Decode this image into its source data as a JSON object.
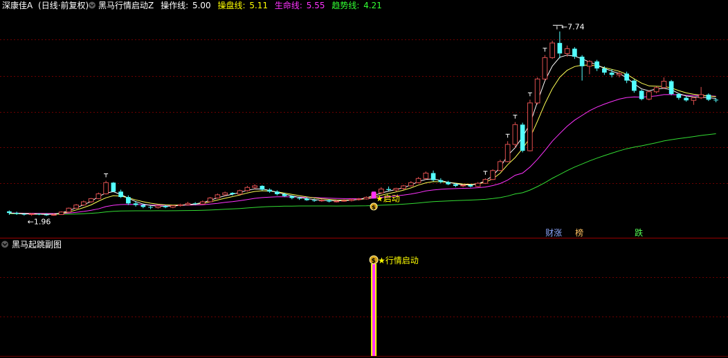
{
  "main_header": {
    "stock": "深康佳A",
    "period": "(日线·前复权)",
    "indicator": "黑马行情启动Z",
    "cz_label": "操作线:",
    "cz_value": "5.00",
    "cp_label": "操盘线:",
    "cp_value": "5.11",
    "sm_label": "生命线:",
    "sm_value": "5.55",
    "qs_label": "趋势线:",
    "qs_value": "4.21"
  },
  "sub_header": {
    "title": "黑马起跳副图"
  },
  "signals": {
    "start_main": "启动",
    "start_sub": "行情启动",
    "dollar": "$"
  },
  "news_tags": [
    "财涨",
    "榜",
    "跌"
  ],
  "colors": {
    "bg": "#000000",
    "grid": "#6e0000",
    "up": "#e05050",
    "down": "#54ffff",
    "ma_white": "#ffffff",
    "ma_yellow": "#ffff55",
    "ma_magenta": "#ff33ff",
    "ma_green": "#33dd33",
    "header_white": "#ffffff",
    "header_yellow": "#ffff00",
    "header_magenta": "#ff33ff",
    "header_green": "#33ff33",
    "tag_blue": "#8da8ff",
    "tag_orange": "#ffc060",
    "tag_green": "#55ff55"
  },
  "chart_data": {
    "type": "candlestick",
    "high_label": "7.74",
    "low_label": "1.96",
    "ylim": [
      1.75,
      8.25
    ],
    "ohlc": [
      [
        2.1,
        2.13,
        1.99,
        2.05
      ],
      [
        2.05,
        2.09,
        1.99,
        2.02
      ],
      [
        2.02,
        2.05,
        1.97,
        2.0
      ],
      [
        2.0,
        2.05,
        1.96,
        2.02
      ],
      [
        2.02,
        2.04,
        1.98,
        2.0
      ],
      [
        2.0,
        2.04,
        1.96,
        1.99
      ],
      [
        1.99,
        2.03,
        1.96,
        2.0
      ],
      [
        2.0,
        2.1,
        1.99,
        2.08
      ],
      [
        2.08,
        2.22,
        2.06,
        2.2
      ],
      [
        2.2,
        2.33,
        2.18,
        2.3
      ],
      [
        2.3,
        2.44,
        2.27,
        2.4
      ],
      [
        2.4,
        2.52,
        2.37,
        2.5
      ],
      [
        2.5,
        2.69,
        2.48,
        2.65
      ],
      [
        2.65,
        3.06,
        2.63,
        3.0
      ],
      [
        3.0,
        3.02,
        2.7,
        2.72
      ],
      [
        2.72,
        2.78,
        2.52,
        2.55
      ],
      [
        2.55,
        2.6,
        2.3,
        2.35
      ],
      [
        2.35,
        2.42,
        2.25,
        2.3
      ],
      [
        2.3,
        2.34,
        2.2,
        2.24
      ],
      [
        2.24,
        2.27,
        2.17,
        2.22
      ],
      [
        2.22,
        2.3,
        2.19,
        2.27
      ],
      [
        2.27,
        2.3,
        2.2,
        2.23
      ],
      [
        2.23,
        2.3,
        2.2,
        2.28
      ],
      [
        2.28,
        2.34,
        2.25,
        2.31
      ],
      [
        2.31,
        2.4,
        2.28,
        2.35
      ],
      [
        2.35,
        2.39,
        2.3,
        2.33
      ],
      [
        2.33,
        2.44,
        2.31,
        2.4
      ],
      [
        2.4,
        2.55,
        2.38,
        2.52
      ],
      [
        2.52,
        2.66,
        2.5,
        2.62
      ],
      [
        2.62,
        2.72,
        2.58,
        2.68
      ],
      [
        2.68,
        2.7,
        2.6,
        2.64
      ],
      [
        2.64,
        2.78,
        2.62,
        2.75
      ],
      [
        2.75,
        2.9,
        2.72,
        2.85
      ],
      [
        2.85,
        2.95,
        2.8,
        2.9
      ],
      [
        2.9,
        2.92,
        2.75,
        2.78
      ],
      [
        2.78,
        2.82,
        2.68,
        2.72
      ],
      [
        2.72,
        2.76,
        2.6,
        2.64
      ],
      [
        2.64,
        2.68,
        2.55,
        2.58
      ],
      [
        2.58,
        2.6,
        2.48,
        2.52
      ],
      [
        2.52,
        2.56,
        2.46,
        2.5
      ],
      [
        2.5,
        2.54,
        2.43,
        2.45
      ],
      [
        2.45,
        2.5,
        2.4,
        2.43
      ],
      [
        2.43,
        2.48,
        2.4,
        2.45
      ],
      [
        2.45,
        2.48,
        2.38,
        2.41
      ],
      [
        2.41,
        2.46,
        2.38,
        2.42
      ],
      [
        2.42,
        2.48,
        2.4,
        2.44
      ],
      [
        2.44,
        2.5,
        2.41,
        2.47
      ],
      [
        2.47,
        2.52,
        2.44,
        2.49
      ],
      [
        2.49,
        2.57,
        2.47,
        2.54
      ],
      [
        2.54,
        2.72,
        2.52,
        2.68
      ],
      [
        2.68,
        2.86,
        2.65,
        2.8
      ],
      [
        2.8,
        2.88,
        2.74,
        2.77
      ],
      [
        2.77,
        2.84,
        2.72,
        2.82
      ],
      [
        2.82,
        2.93,
        2.78,
        2.9
      ],
      [
        2.9,
        3.05,
        2.88,
        3.0
      ],
      [
        3.0,
        3.18,
        2.98,
        3.13
      ],
      [
        3.13,
        3.35,
        3.1,
        3.3
      ],
      [
        3.3,
        3.38,
        3.04,
        3.08
      ],
      [
        3.08,
        3.14,
        2.98,
        3.02
      ],
      [
        3.02,
        3.06,
        2.92,
        2.95
      ],
      [
        2.95,
        2.99,
        2.86,
        2.9
      ],
      [
        2.9,
        2.94,
        2.86,
        2.92
      ],
      [
        2.92,
        2.96,
        2.85,
        2.88
      ],
      [
        2.88,
        3.02,
        2.86,
        2.98
      ],
      [
        2.98,
        3.14,
        2.96,
        3.1
      ],
      [
        3.1,
        3.42,
        3.08,
        3.38
      ],
      [
        3.38,
        3.72,
        3.36,
        3.66
      ],
      [
        3.66,
        4.3,
        3.64,
        4.2
      ],
      [
        4.2,
        4.9,
        4.1,
        4.82
      ],
      [
        4.82,
        4.88,
        3.95,
        4.0
      ],
      [
        4.0,
        5.6,
        3.98,
        5.5
      ],
      [
        5.5,
        6.3,
        5.45,
        6.25
      ],
      [
        6.25,
        7.0,
        6.2,
        6.92
      ],
      [
        6.92,
        7.45,
        6.88,
        7.38
      ],
      [
        7.38,
        7.74,
        6.9,
        7.05
      ],
      [
        7.05,
        7.3,
        6.95,
        7.2
      ],
      [
        7.2,
        7.25,
        6.88,
        6.95
      ],
      [
        6.95,
        7.0,
        6.2,
        6.65
      ],
      [
        6.65,
        6.84,
        6.4,
        6.8
      ],
      [
        6.8,
        6.85,
        6.5,
        6.58
      ],
      [
        6.58,
        6.65,
        6.38,
        6.45
      ],
      [
        6.45,
        6.55,
        6.3,
        6.38
      ],
      [
        6.38,
        6.48,
        6.3,
        6.42
      ],
      [
        6.42,
        6.48,
        6.12,
        6.2
      ],
      [
        6.2,
        6.25,
        5.82,
        5.88
      ],
      [
        5.88,
        5.92,
        5.58,
        5.62
      ],
      [
        5.62,
        5.9,
        5.58,
        5.85
      ],
      [
        5.85,
        6.02,
        5.8,
        5.98
      ],
      [
        5.98,
        6.3,
        5.94,
        6.18
      ],
      [
        6.18,
        6.22,
        5.74,
        5.78
      ],
      [
        5.78,
        5.8,
        5.6,
        5.66
      ],
      [
        5.66,
        5.7,
        5.54,
        5.58
      ],
      [
        5.58,
        5.7,
        5.44,
        5.66
      ],
      [
        5.66,
        6.0,
        5.62,
        5.76
      ],
      [
        5.76,
        5.8,
        5.56,
        5.6
      ],
      [
        5.6,
        5.65,
        5.52,
        5.58
      ]
    ]
  }
}
